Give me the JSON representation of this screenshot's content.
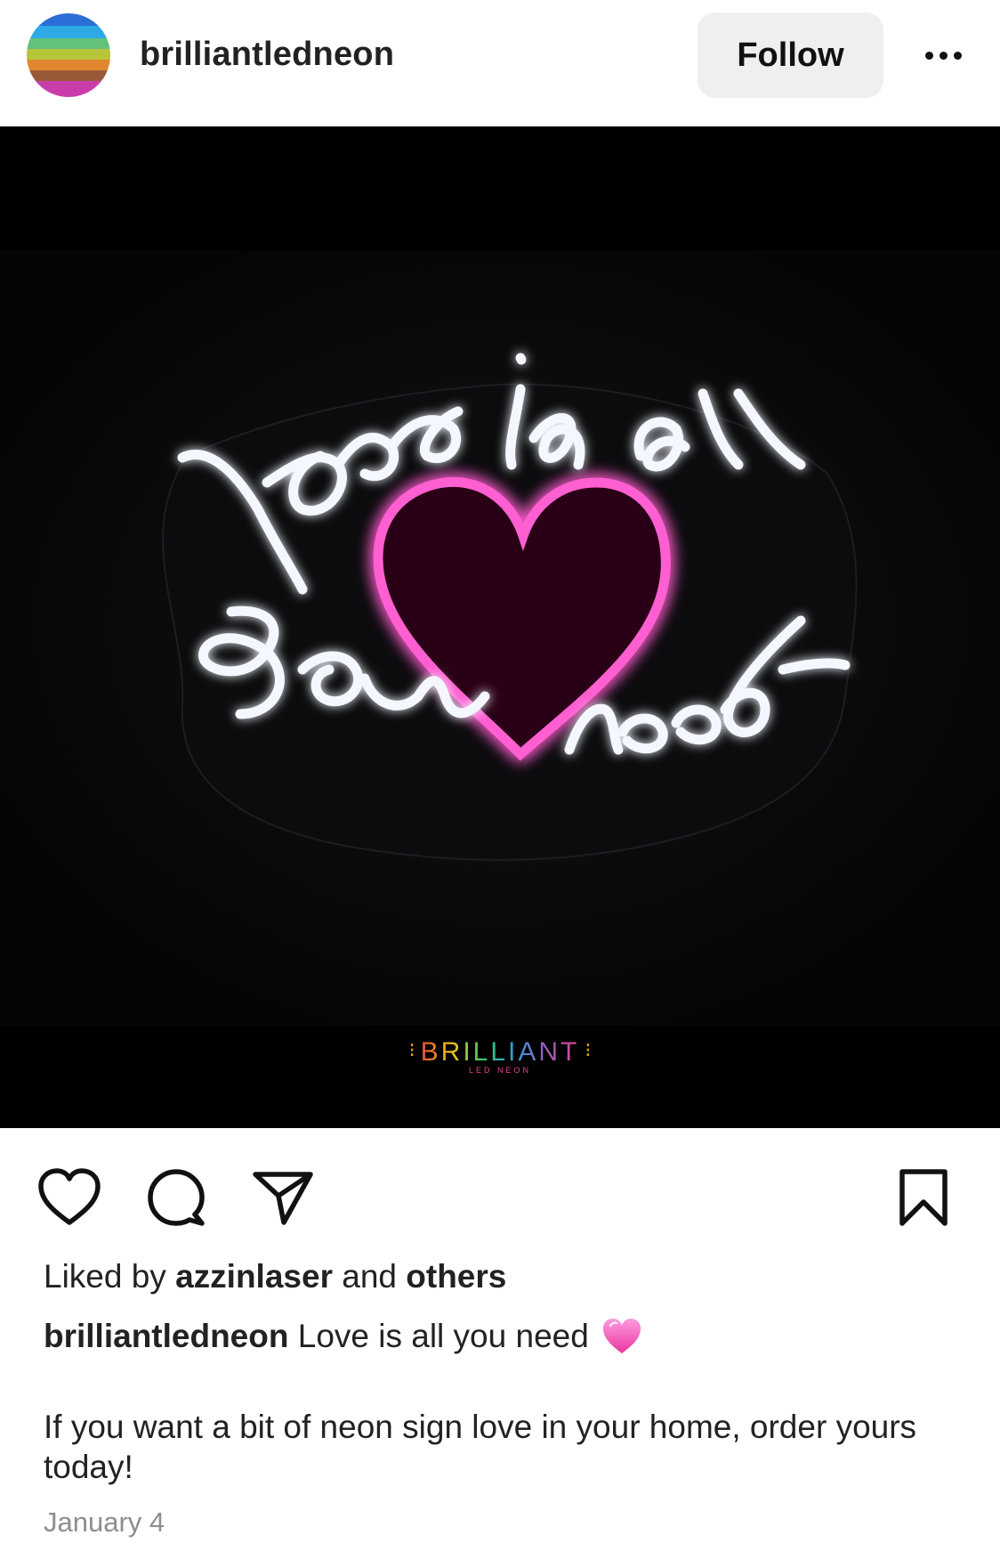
{
  "header": {
    "username": "brilliantledneon",
    "follow_label": "Follow"
  },
  "post": {
    "image_alt": "Neon sign: love is all you need with a pink heart",
    "brand": {
      "name": "BRILLIANT",
      "sub": "LED NEON"
    },
    "neon_text": {
      "line1": "love is all",
      "line2": "you need"
    }
  },
  "actions": {
    "icons": [
      "heart-icon",
      "comment-icon",
      "share-icon",
      "bookmark-icon"
    ]
  },
  "likes": {
    "prefix": "Liked by",
    "user": "azzinlaser",
    "middle": "and",
    "others": "others"
  },
  "caption": {
    "username": "brilliantledneon",
    "text": "Love is all you need",
    "body": "If you want a bit of neon sign love in your home, order yours today!"
  },
  "date": "January 4",
  "colors": {
    "follow_bg": "#efefef",
    "neon_pink": "#ff4fc8",
    "neon_white": "#f4f7ff",
    "muted_text": "#8e8e8e"
  }
}
